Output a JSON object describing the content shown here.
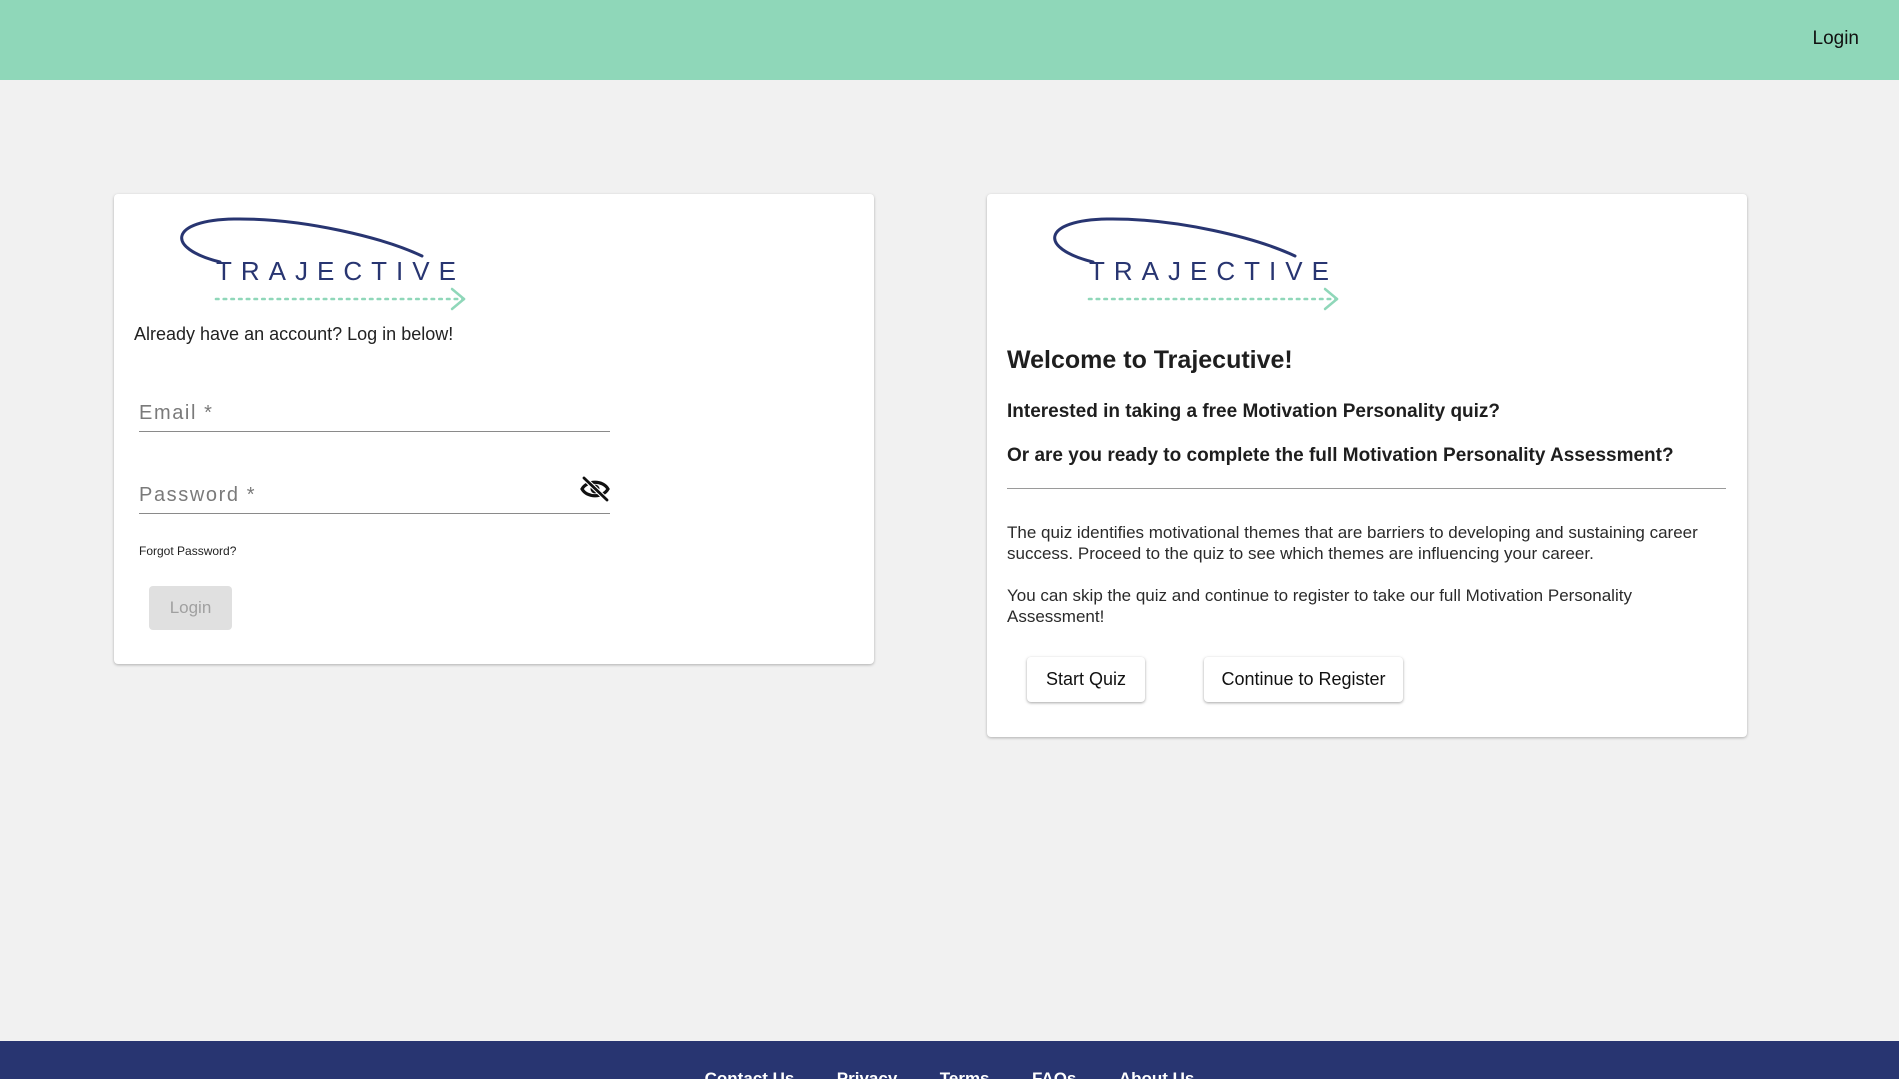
{
  "header": {
    "login_label": "Login"
  },
  "brand": {
    "wordmark": "TRAJECTIVE",
    "colors": {
      "navy": "#283571",
      "mint": "#8fd7b9"
    }
  },
  "login_card": {
    "intro": "Already have an account? Log in below!",
    "email_label": "Email *",
    "password_label": "Password *",
    "password_toggle_icon": "eye-off-icon",
    "forgot_label": "Forgot Password?",
    "login_button_label": "Login",
    "login_button_state": "disabled"
  },
  "welcome_card": {
    "title": "Welcome to Trajecutive!",
    "question_quiz": "Interested in taking a free Motivation Personality quiz?",
    "question_assessment": "Or are you ready to complete the full Motivation Personality Assessment?",
    "paragraph_quiz": "The quiz identifies motivational themes that are barriers to developing and sustaining career success. Proceed to the quiz to see which themes are influencing your career.",
    "paragraph_register": "You can skip the quiz and continue to register to take our full Motivation Personality Assessment!",
    "start_quiz_label": "Start Quiz",
    "register_label": "Continue to Register"
  },
  "footer": {
    "links": [
      "Contact Us",
      "Privacy",
      "Terms",
      "FAQs",
      "About Us"
    ]
  }
}
